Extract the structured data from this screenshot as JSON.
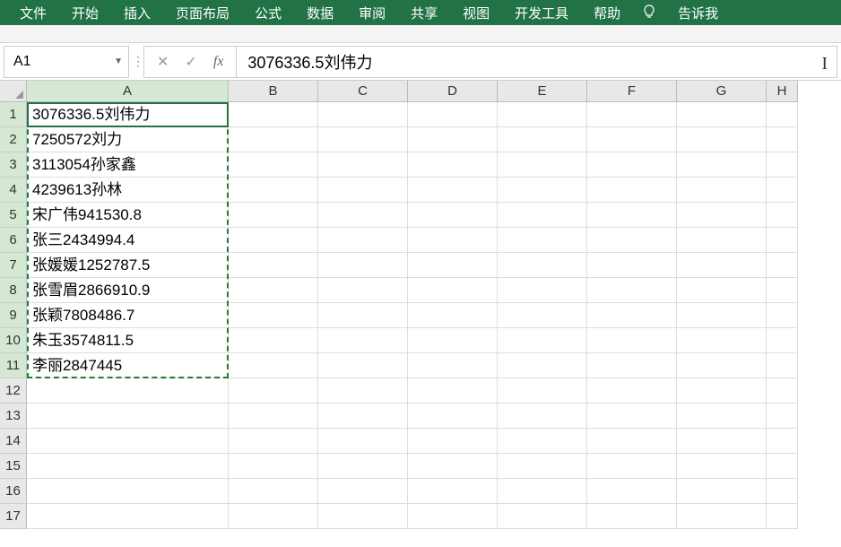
{
  "ribbon": {
    "tabs": [
      "文件",
      "开始",
      "插入",
      "页面布局",
      "公式",
      "数据",
      "审阅",
      "共享",
      "视图",
      "开发工具",
      "帮助"
    ],
    "tell_me": "告诉我"
  },
  "name_box": {
    "value": "A1"
  },
  "formula_bar": {
    "value": "3076336.5刘伟力"
  },
  "columns": [
    "A",
    "B",
    "C",
    "D",
    "E",
    "F",
    "G",
    "H"
  ],
  "row_count": 17,
  "selected_rows_end": 11,
  "data_A": [
    "3076336.5刘伟力",
    "7250572刘力",
    "3113054孙家鑫",
    "4239613孙林",
    "宋广伟941530.8",
    "张三2434994.4",
    "张媛媛1252787.5",
    "张雪眉2866910.9",
    "张颖7808486.7",
    "朱玉3574811.5",
    "李丽2847445"
  ]
}
